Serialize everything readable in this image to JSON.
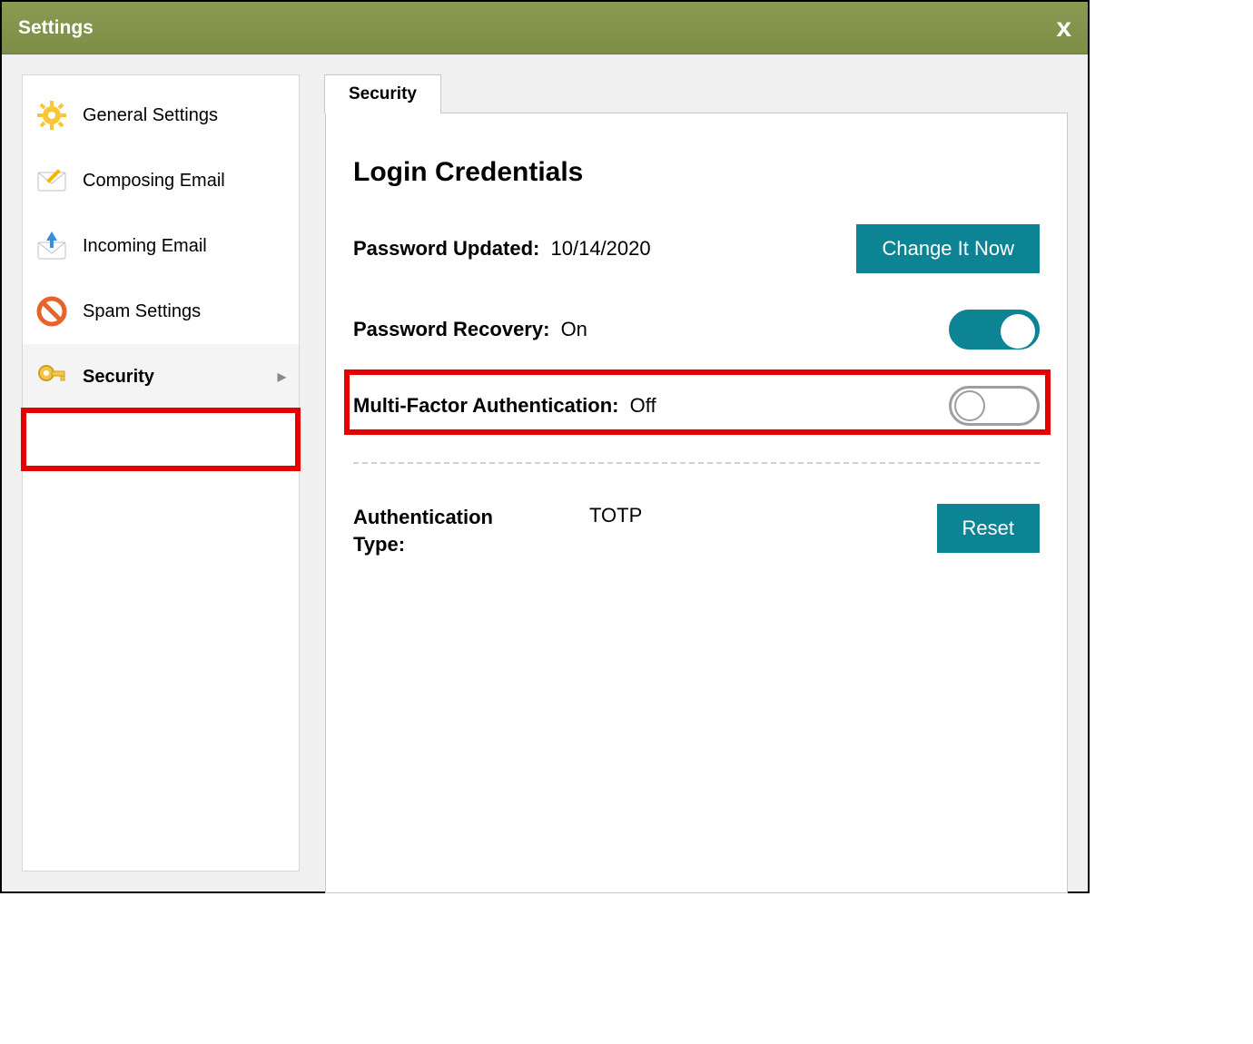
{
  "window": {
    "title": "Settings"
  },
  "sidebar": {
    "items": [
      {
        "label": "General Settings"
      },
      {
        "label": "Composing Email"
      },
      {
        "label": "Incoming Email"
      },
      {
        "label": "Spam Settings"
      },
      {
        "label": "Security"
      }
    ]
  },
  "tab": {
    "label": "Security"
  },
  "section": {
    "heading": "Login Credentials",
    "password_updated_label": "Password Updated:",
    "password_updated_value": "10/14/2020",
    "change_button": "Change It Now",
    "password_recovery_label": "Password Recovery:",
    "password_recovery_value": "On",
    "mfa_label": "Multi-Factor Authentication:",
    "mfa_value": "Off",
    "auth_type_label": "Authentication Type:",
    "auth_type_value": "TOTP",
    "reset_button": "Reset"
  },
  "colors": {
    "accent": "#0c8494",
    "olive": "#7d8e46",
    "highlight": "#e60000"
  }
}
